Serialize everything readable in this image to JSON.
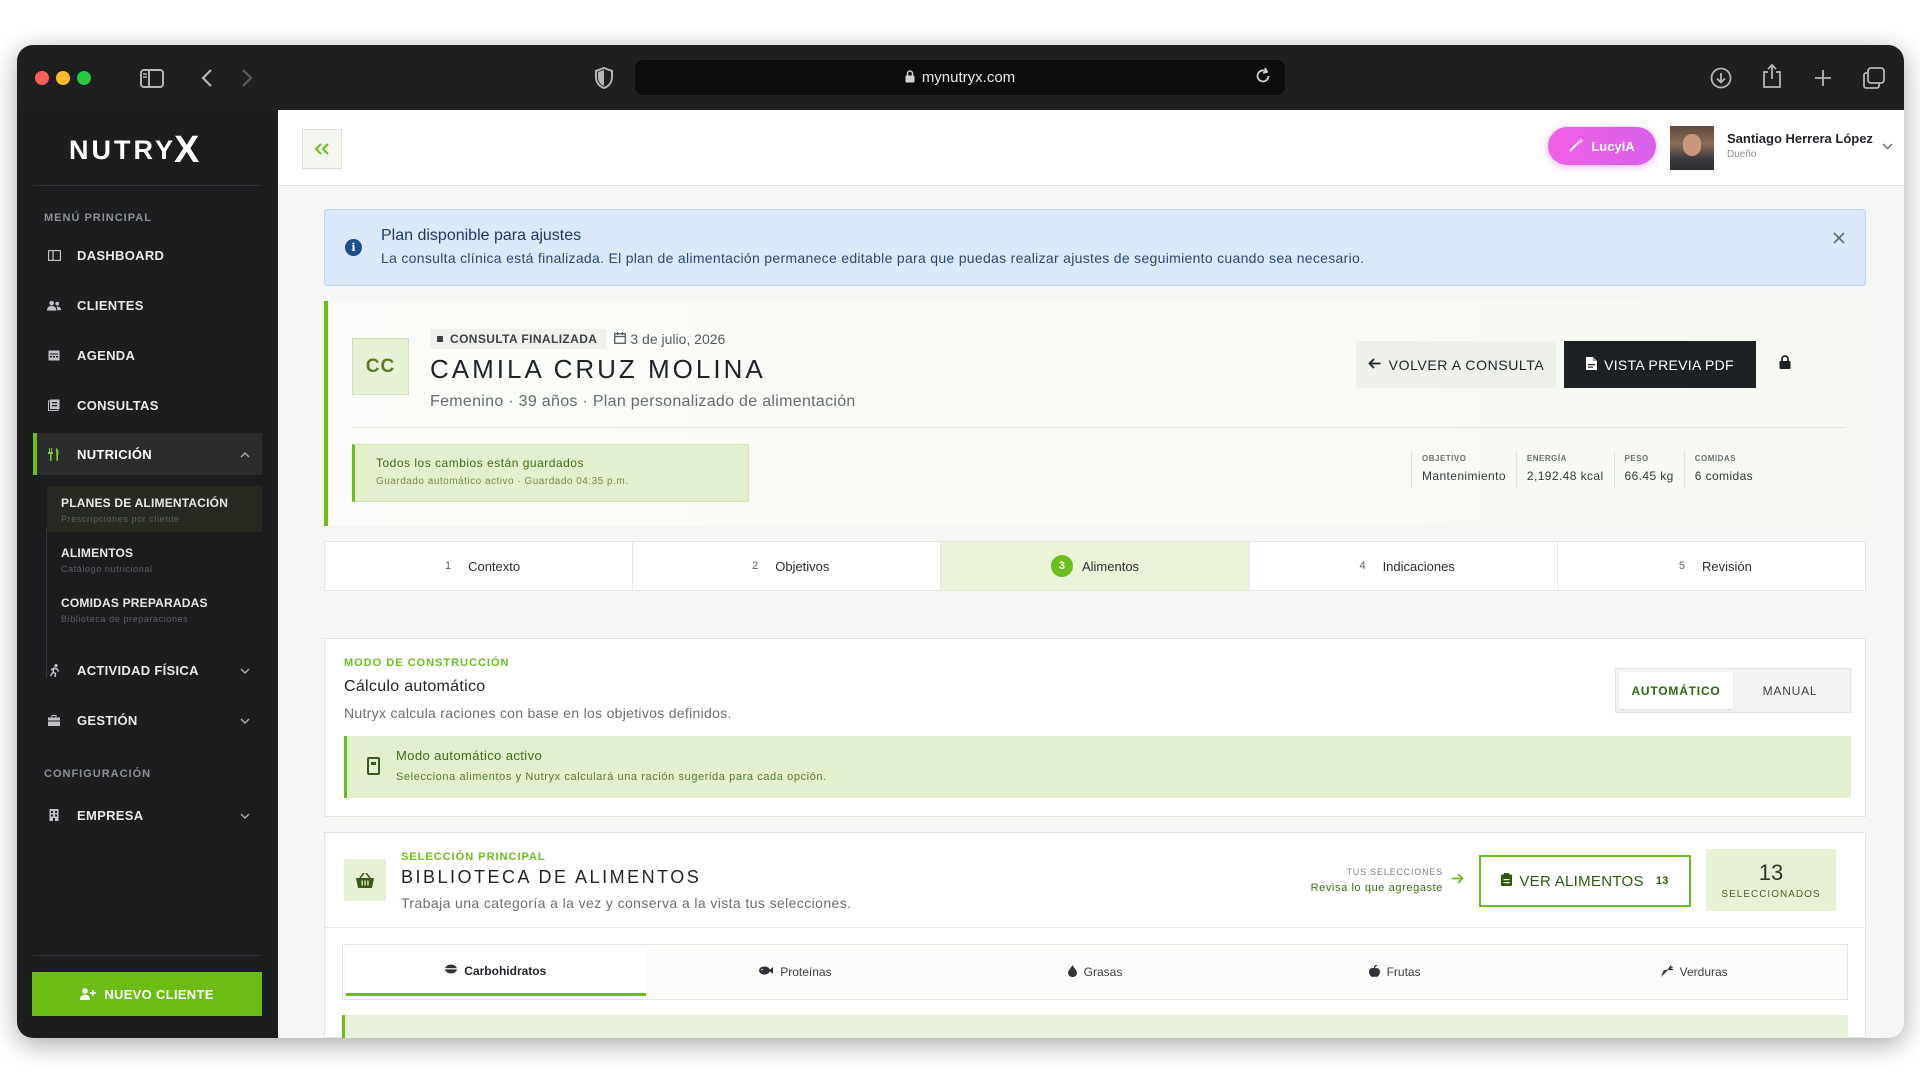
{
  "browser": {
    "url": "mynutryx.com"
  },
  "sidebar": {
    "logo": "NUTRY",
    "logo_mark": "X",
    "section_main": "MENÚ PRINCIPAL",
    "items": [
      {
        "label": "DASHBOARD",
        "icon": "dashboard-icon"
      },
      {
        "label": "CLIENTES",
        "icon": "users-icon"
      },
      {
        "label": "AGENDA",
        "icon": "calendar-icon"
      },
      {
        "label": "CONSULTAS",
        "icon": "consultations-icon"
      },
      {
        "label": "NUTRICIÓN",
        "icon": "utensils-icon",
        "active": true
      }
    ],
    "sub_items": [
      {
        "label": "PLANES DE ALIMENTACIÓN",
        "sub": "Prescripciones por cliente",
        "active": true
      },
      {
        "label": "ALIMENTOS",
        "sub": "Catálogo nutricional"
      },
      {
        "label": "COMIDAS PREPARADAS",
        "sub": "Biblioteca de preparaciones"
      }
    ],
    "items_more": [
      {
        "label": "ACTIVIDAD FÍSICA",
        "icon": "running-icon"
      },
      {
        "label": "GESTIÓN",
        "icon": "briefcase-icon"
      }
    ],
    "section_config": "CONFIGURACIÓN",
    "config_items": [
      {
        "label": "EMPRESA",
        "icon": "building-icon"
      }
    ],
    "new_client": "NUEVO CLIENTE"
  },
  "topbar": {
    "lucy": "LucyIA",
    "user_name": "Santiago Herrera López",
    "user_role": "Dueño"
  },
  "alert": {
    "title": "Plan disponible para ajustes",
    "text": "La consulta clínica está finalizada. El plan de alimentación permanece editable para que puedas realizar ajustes de seguimiento cuando sea necesario."
  },
  "patient": {
    "initials": "CC",
    "status": "CONSULTA FINALIZADA",
    "date": "3 de julio, 2026",
    "name": "CAMILA CRUZ MOLINA",
    "meta": "Femenino · 39 años · Plan personalizado de alimentación",
    "back_button": "VOLVER A CONSULTA",
    "pdf_button": "VISTA PREVIA PDF",
    "saved_title": "Todos los cambios están guardados",
    "saved_sub": "Guardado automático activo · Guardado 04:35 p.m.",
    "stats": [
      {
        "label": "OBJETIVO",
        "value": "Mantenimiento"
      },
      {
        "label": "ENERGÍA",
        "value": "2,192.48 kcal"
      },
      {
        "label": "PESO",
        "value": "66.45 kg"
      },
      {
        "label": "COMIDAS",
        "value": "6 comidas"
      }
    ]
  },
  "steps": [
    {
      "n": "1",
      "label": "Contexto"
    },
    {
      "n": "2",
      "label": "Objetivos"
    },
    {
      "n": "3",
      "label": "Alimentos",
      "active": true
    },
    {
      "n": "4",
      "label": "Indicaciones"
    },
    {
      "n": "5",
      "label": "Revisión"
    }
  ],
  "build": {
    "kicker": "MODO DE CONSTRUCCIÓN",
    "title": "Cálculo automático",
    "desc": "Nutryx calcula raciones con base en los objetivos definidos.",
    "opt_auto": "AUTOMÁTICO",
    "opt_manual": "MANUAL",
    "auto_title": "Modo automático activo",
    "auto_sub": "Selecciona alimentos y Nutryx calculará una ración sugerida para cada opción."
  },
  "library": {
    "kicker": "SELECCIÓN PRINCIPAL",
    "title": "BIBLIOTECA DE ALIMENTOS",
    "desc": "Trabaja una categoría a la vez y conserva a la vista tus selecciones.",
    "your_label": "TUS SELECCIONES",
    "your_value": "Revisa lo que agregaste",
    "view_button": "VER ALIMENTOS",
    "view_count": "13",
    "selected_count": "13",
    "selected_label": "SELECCIONADOS",
    "categories": [
      {
        "label": "Carbohidratos",
        "icon": "bread-icon",
        "active": true
      },
      {
        "label": "Proteínas",
        "icon": "fish-icon"
      },
      {
        "label": "Grasas",
        "icon": "drop-icon"
      },
      {
        "label": "Frutas",
        "icon": "apple-icon"
      },
      {
        "label": "Verduras",
        "icon": "carrot-icon"
      }
    ]
  }
}
